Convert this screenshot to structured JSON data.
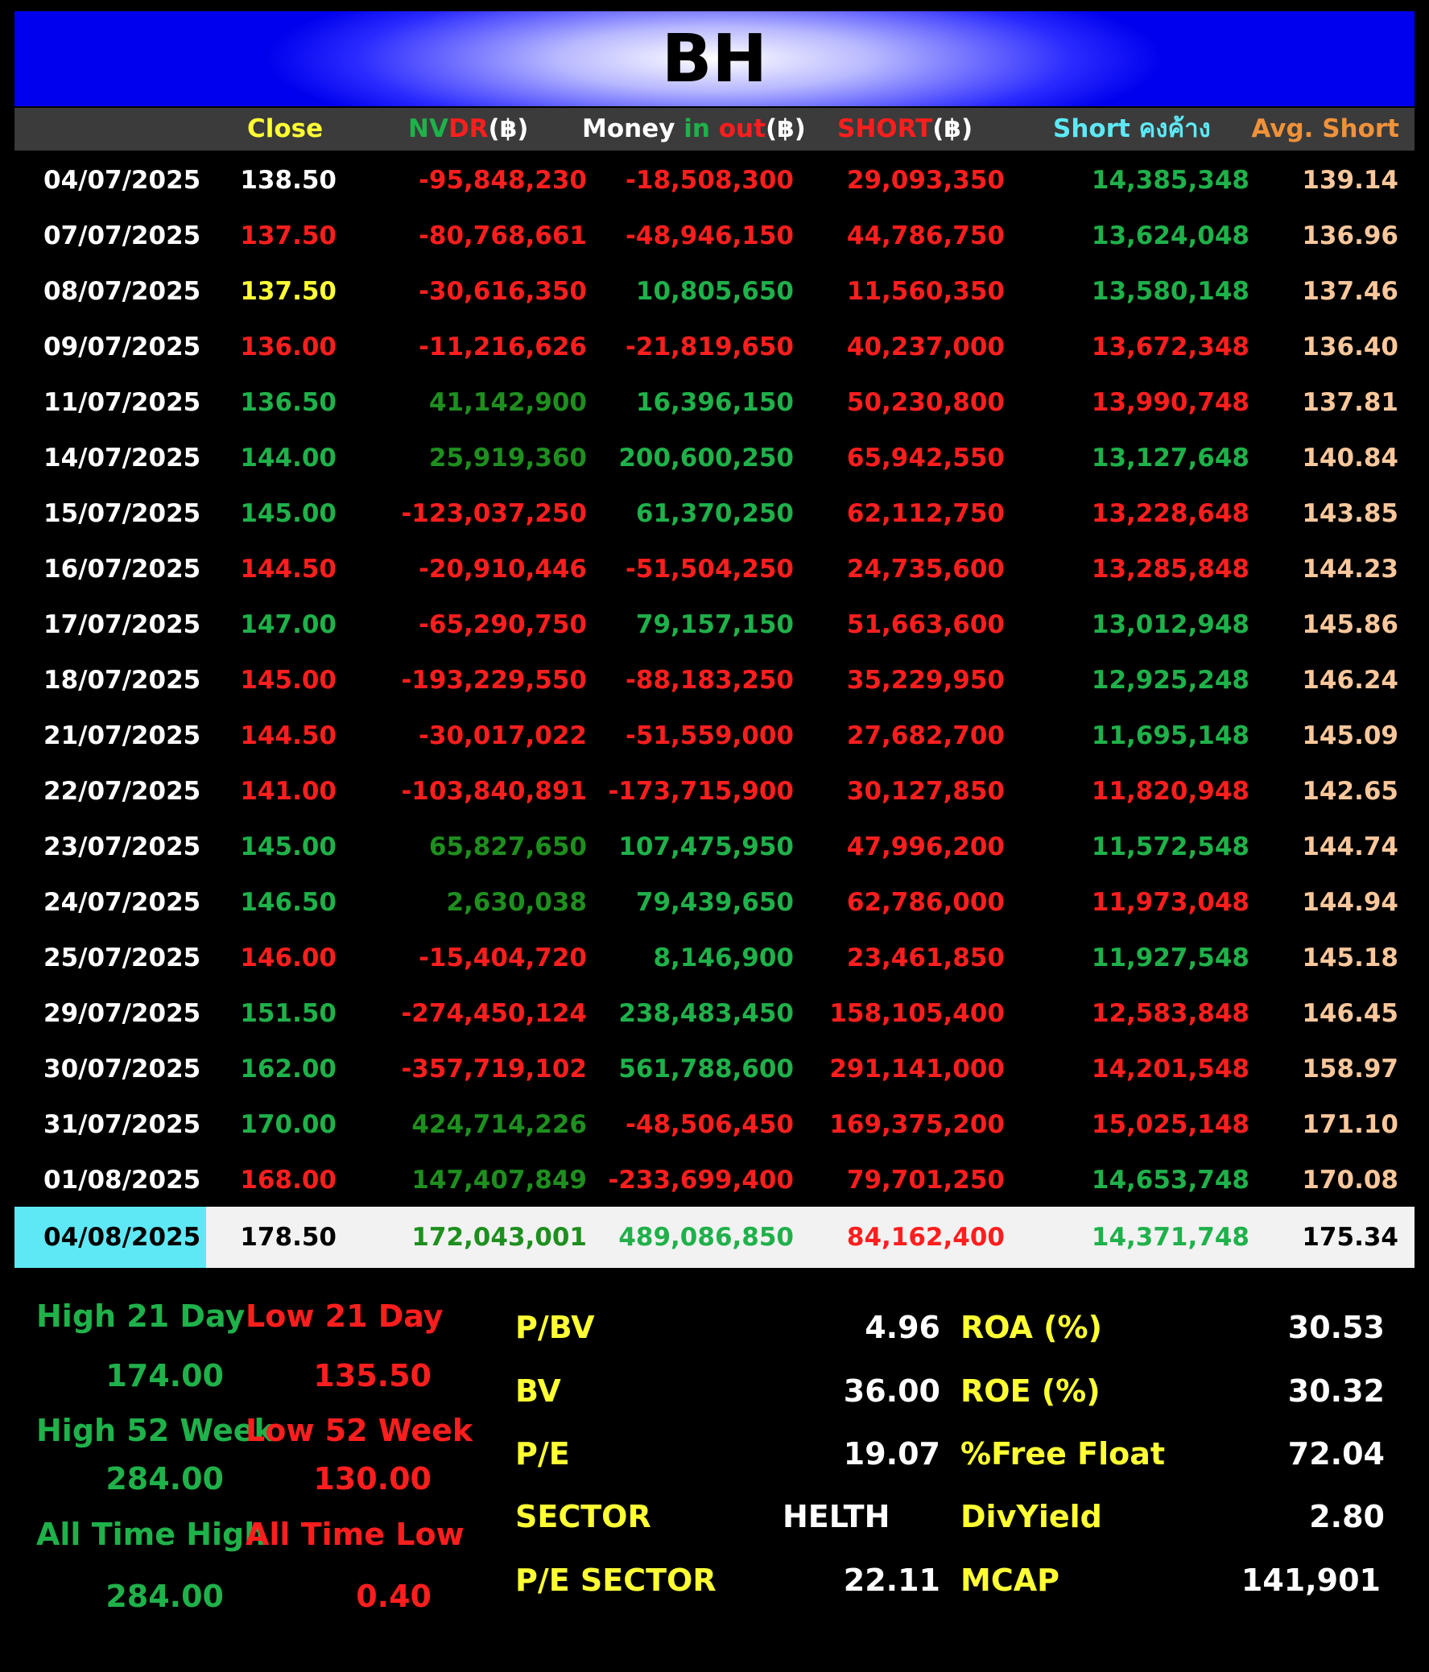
{
  "title": "BH",
  "headers": {
    "close": "Close",
    "nvdr_a": "NV",
    "nvdr_b": "DR",
    "nvdr_c": "(฿)",
    "money_a": "Money ",
    "money_b": "in ",
    "money_c": "out",
    "money_d": "(฿)",
    "short_a": "SHORT",
    "short_b": "(฿)",
    "outst": "Short คงค้าง",
    "avg": "Avg. Short"
  },
  "rows": [
    {
      "date": "04/07/2025",
      "close": "138.50",
      "nvdr": "-95,848,230",
      "money": "-18,508,300",
      "short": "29,093,350",
      "outst": "14,385,348",
      "avg": "139.14"
    },
    {
      "date": "07/07/2025",
      "close": "137.50",
      "nvdr": "-80,768,661",
      "money": "-48,946,150",
      "short": "44,786,750",
      "outst": "13,624,048",
      "avg": "136.96"
    },
    {
      "date": "08/07/2025",
      "close": "137.50",
      "nvdr": "-30,616,350",
      "money": "10,805,650",
      "short": "11,560,350",
      "outst": "13,580,148",
      "avg": "137.46"
    },
    {
      "date": "09/07/2025",
      "close": "136.00",
      "nvdr": "-11,216,626",
      "money": "-21,819,650",
      "short": "40,237,000",
      "outst": "13,672,348",
      "avg": "136.40"
    },
    {
      "date": "11/07/2025",
      "close": "136.50",
      "nvdr": "41,142,900",
      "money": "16,396,150",
      "short": "50,230,800",
      "outst": "13,990,748",
      "avg": "137.81"
    },
    {
      "date": "14/07/2025",
      "close": "144.00",
      "nvdr": "25,919,360",
      "money": "200,600,250",
      "short": "65,942,550",
      "outst": "13,127,648",
      "avg": "140.84"
    },
    {
      "date": "15/07/2025",
      "close": "145.00",
      "nvdr": "-123,037,250",
      "money": "61,370,250",
      "short": "62,112,750",
      "outst": "13,228,648",
      "avg": "143.85"
    },
    {
      "date": "16/07/2025",
      "close": "144.50",
      "nvdr": "-20,910,446",
      "money": "-51,504,250",
      "short": "24,735,600",
      "outst": "13,285,848",
      "avg": "144.23"
    },
    {
      "date": "17/07/2025",
      "close": "147.00",
      "nvdr": "-65,290,750",
      "money": "79,157,150",
      "short": "51,663,600",
      "outst": "13,012,948",
      "avg": "145.86"
    },
    {
      "date": "18/07/2025",
      "close": "145.00",
      "nvdr": "-193,229,550",
      "money": "-88,183,250",
      "short": "35,229,950",
      "outst": "12,925,248",
      "avg": "146.24"
    },
    {
      "date": "21/07/2025",
      "close": "144.50",
      "nvdr": "-30,017,022",
      "money": "-51,559,000",
      "short": "27,682,700",
      "outst": "11,695,148",
      "avg": "145.09"
    },
    {
      "date": "22/07/2025",
      "close": "141.00",
      "nvdr": "-103,840,891",
      "money": "-173,715,900",
      "short": "30,127,850",
      "outst": "11,820,948",
      "avg": "142.65"
    },
    {
      "date": "23/07/2025",
      "close": "145.00",
      "nvdr": "65,827,650",
      "money": "107,475,950",
      "short": "47,996,200",
      "outst": "11,572,548",
      "avg": "144.74"
    },
    {
      "date": "24/07/2025",
      "close": "146.50",
      "nvdr": "2,630,038",
      "money": "79,439,650",
      "short": "62,786,000",
      "outst": "11,973,048",
      "avg": "144.94"
    },
    {
      "date": "25/07/2025",
      "close": "146.00",
      "nvdr": "-15,404,720",
      "money": "8,146,900",
      "short": "23,461,850",
      "outst": "11,927,548",
      "avg": "145.18"
    },
    {
      "date": "29/07/2025",
      "close": "151.50",
      "nvdr": "-274,450,124",
      "money": "238,483,450",
      "short": "158,105,400",
      "outst": "12,583,848",
      "avg": "146.45"
    },
    {
      "date": "30/07/2025",
      "close": "162.00",
      "nvdr": "-357,719,102",
      "money": "561,788,600",
      "short": "291,141,000",
      "outst": "14,201,548",
      "avg": "158.97"
    },
    {
      "date": "31/07/2025",
      "close": "170.00",
      "nvdr": "424,714,226",
      "money": "-48,506,450",
      "short": "169,375,200",
      "outst": "15,025,148",
      "avg": "171.10"
    },
    {
      "date": "01/08/2025",
      "close": "168.00",
      "nvdr": "147,407,849",
      "money": "-233,699,400",
      "short": "79,701,250",
      "outst": "14,653,748",
      "avg": "170.08"
    }
  ],
  "colors": {
    "close": [
      "white",
      "red",
      "yellow",
      "red",
      "green",
      "green",
      "green",
      "red",
      "green",
      "red",
      "red",
      "red",
      "green",
      "green",
      "red",
      "green",
      "green",
      "green",
      "red"
    ],
    "nvdr": [
      "red",
      "red",
      "red",
      "red",
      "dgreen",
      "dgreen",
      "red",
      "red",
      "red",
      "red",
      "red",
      "red",
      "dgreen",
      "dgreen",
      "red",
      "red",
      "red",
      "dgreen",
      "dgreen"
    ],
    "money": [
      "red",
      "red",
      "green",
      "red",
      "green",
      "green",
      "green",
      "red",
      "green",
      "red",
      "red",
      "red",
      "green",
      "green",
      "green",
      "green",
      "green",
      "red",
      "red"
    ],
    "short": [
      "red",
      "red",
      "red",
      "red",
      "red",
      "red",
      "red",
      "red",
      "red",
      "red",
      "red",
      "red",
      "red",
      "red",
      "red",
      "red",
      "red",
      "red",
      "red"
    ],
    "outst": [
      "green",
      "green",
      "green",
      "red",
      "red",
      "green",
      "red",
      "red",
      "green",
      "green",
      "green",
      "red",
      "green",
      "red",
      "green",
      "red",
      "red",
      "red",
      "green"
    ]
  },
  "latest": {
    "date": "04/08/2025",
    "close": "178.50",
    "nvdr": "172,043,001",
    "money": "489,086,850",
    "short": "84,162,400",
    "outst": "14,371,748",
    "avg": "175.34"
  },
  "stats": {
    "high21_label": "High 21 Day",
    "low21_label": "Low 21 Day",
    "high21": "174.00",
    "low21": "135.50",
    "high52_label": "High 52 Week",
    "low52_label": "Low 52 Week",
    "high52": "284.00",
    "low52": "130.00",
    "ath_label": "All Time High",
    "atl_label": "All Time Low",
    "ath": "284.00",
    "atl": "0.40"
  },
  "fundamentals": {
    "pbv_label": "P/BV",
    "pbv": "4.96",
    "roa_label": "ROA (%)",
    "roa": "30.53",
    "bv_label": "BV",
    "bv": "36.00",
    "roe_label": "ROE (%)",
    "roe": "30.32",
    "pe_label": "P/E",
    "pe": "19.07",
    "ff_label": "%Free Float",
    "ff": "72.04",
    "sector_label": "SECTOR",
    "sector": "HELTH",
    "div_label": "DivYield",
    "div": "2.80",
    "pes_label": "P/E SECTOR",
    "pes": "22.11",
    "mcap_label": "MCAP",
    "mcap": "141,901"
  }
}
